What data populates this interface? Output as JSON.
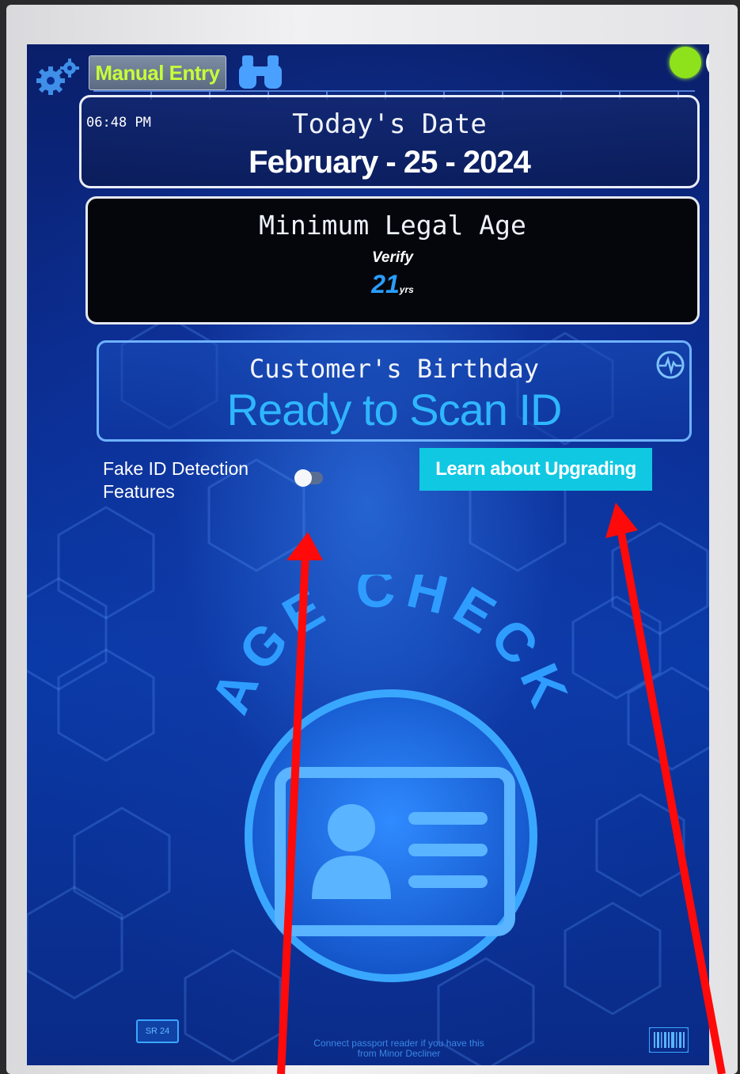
{
  "toolbar": {
    "settings_icon": "gear-icon",
    "manual_entry_label": "Manual Entry",
    "binoculars_icon": "binoculars-icon",
    "status_indicators": [
      {
        "color": "#8ee21c"
      },
      {
        "color": "#f2f3f5"
      }
    ]
  },
  "date_panel": {
    "time": "06:48 PM",
    "label": "Today's Date",
    "value": "February - 25 - 2024"
  },
  "age_panel": {
    "label": "Minimum Legal Age",
    "verify": "Verify",
    "age": "21",
    "unit": "yrs"
  },
  "birthday_panel": {
    "label": "Customer's Birthday",
    "status": "Ready to Scan ID",
    "icon": "pulse-icon"
  },
  "fake_id": {
    "label_line1": "Fake ID Detection",
    "label_line2": "Features",
    "toggle_on": false
  },
  "upgrade_button": {
    "label": "Learn about Upgrading"
  },
  "logo": {
    "text": "AGE CHECK",
    "icon": "id-card-icon"
  },
  "footer": {
    "badge": "SR 24",
    "note_line1": "Connect passport reader if you have this",
    "note_line2": "from Minor Decliner",
    "barcode_icon": "barcode-icon"
  },
  "colors": {
    "screen_bg": "#0b2c8f",
    "accent_cyan": "#11c8e2",
    "status_text_blue": "#2fb6ff",
    "manual_entry_text": "#c6ff3a",
    "annotation_arrow": "#ff0a0a"
  }
}
